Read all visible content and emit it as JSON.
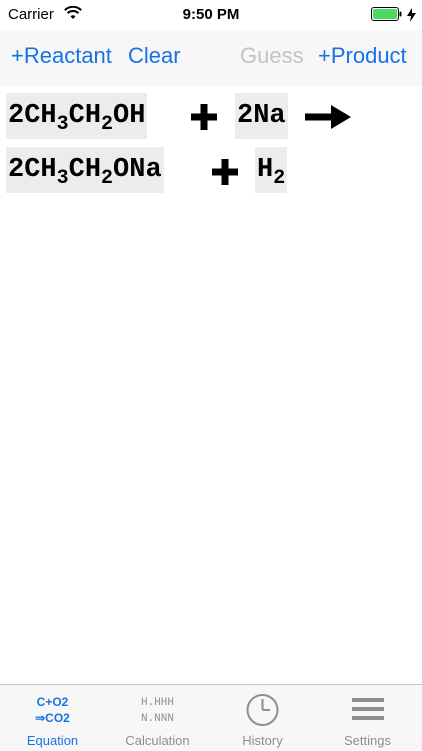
{
  "status_bar": {
    "carrier": "Carrier",
    "time": "9:50 PM",
    "battery_color": "#4cd964"
  },
  "toolbar": {
    "add_reactant": "+Reactant",
    "clear": "Clear",
    "guess": "Guess",
    "add_product": "+Product"
  },
  "equation": {
    "reactants": [
      {
        "coef": "2",
        "parts": [
          "CH",
          "3",
          "CH",
          "2",
          "OH"
        ]
      },
      {
        "coef": "2",
        "parts": [
          "Na"
        ]
      }
    ],
    "products": [
      {
        "coef": "2",
        "parts": [
          "CH",
          "3",
          "CH",
          "2",
          "ONa"
        ]
      },
      {
        "coef": "",
        "parts": [
          "H",
          "2"
        ]
      }
    ]
  },
  "tabs": [
    {
      "label": "Equation",
      "icon": "equation-icon",
      "icon_text": [
        "C+O2",
        "⇒CO2"
      ],
      "active": true
    },
    {
      "label": "Calculation",
      "icon": "calculation-icon",
      "icon_text": [
        "H.HHH",
        "N.NNN"
      ],
      "active": false
    },
    {
      "label": "History",
      "icon": "clock-icon",
      "active": false
    },
    {
      "label": "Settings",
      "icon": "menu-icon",
      "active": false
    }
  ],
  "colors": {
    "accent": "#1673e6",
    "disabled": "#c4c4c4",
    "term_bg": "#ececec"
  }
}
